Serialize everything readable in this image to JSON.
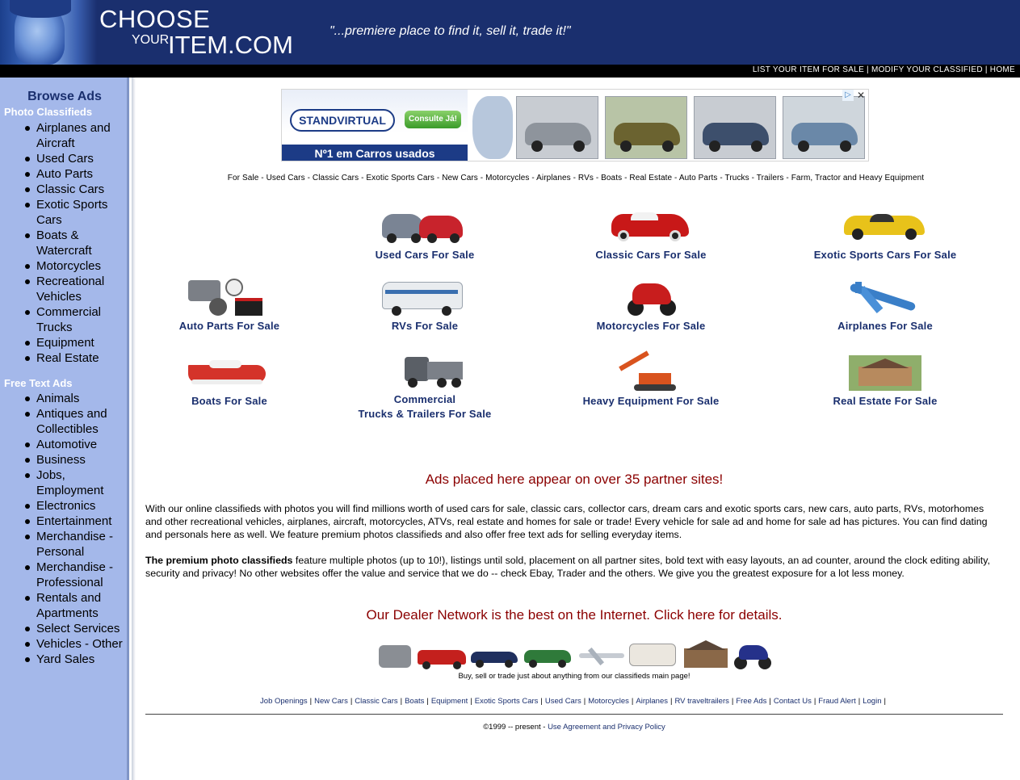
{
  "header": {
    "logo_line1": "CHOOSE",
    "logo_line2_small": "YOUR",
    "logo_line2_big": "ITEM.COM",
    "tagline": "\"...premiere place to find it, sell it, trade it!\"",
    "top_links": [
      "LIST YOUR ITEM FOR SALE",
      "MODIFY YOUR CLASSIFIED",
      "HOME"
    ]
  },
  "sidebar": {
    "title": "Browse Ads",
    "photo_section": "Photo Classifieds",
    "photo_items": [
      "Airplanes and Aircraft",
      "Used Cars",
      "Auto Parts",
      "Classic Cars",
      "Exotic Sports Cars",
      "Boats & Watercraft",
      "Motorcycles",
      "Recreational Vehicles",
      "Commercial Trucks",
      "Equipment",
      "Real Estate"
    ],
    "text_section": "Free Text Ads",
    "text_items": [
      "Animals",
      "Antiques and Collectibles",
      "Automotive",
      "Business",
      "Jobs, Employment",
      "Electronics",
      "Entertainment",
      "Merchandise - Personal",
      "Merchandise - Professional",
      "Rentals and Apartments",
      "Select Services",
      "Vehicles - Other",
      "Yard Sales"
    ]
  },
  "banner": {
    "brand": "STANDVIRTUAL",
    "button": "Consulte Já!",
    "strip": "Nº1 em Carros usados",
    "adchoices_icon": "adchoices-icon",
    "close_icon": "close-icon"
  },
  "category_line": "For Sale - Used Cars - Classic Cars - Exotic Sports Cars - New Cars - Motorcycles - Airplanes - RVs - Boats - Real Estate - Auto Parts - Trucks - Trailers - Farm, Tractor and Heavy Equipment",
  "categories": [
    {
      "label": "Used Cars For Sale"
    },
    {
      "label": "Classic Cars For Sale"
    },
    {
      "label": "Exotic Sports Cars For Sale"
    },
    {
      "label": "Auto Parts For Sale"
    },
    {
      "label": "RVs For Sale"
    },
    {
      "label": "Motorcycles For Sale"
    },
    {
      "label": "Airplanes For Sale"
    },
    {
      "label": "Boats For Sale"
    },
    {
      "label": "Commercial",
      "label2": "Trucks & Trailers For Sale"
    },
    {
      "label": "Heavy Equipment For Sale"
    },
    {
      "label": "Real Estate For Sale"
    }
  ],
  "headline1": "Ads placed here appear on over 35 partner sites!",
  "para1": "With our online classifieds with photos you will find millions worth of used cars for sale, classic cars, collector cars, dream cars and exotic sports cars, new cars, auto parts, RVs, motorhomes and other recreational vehicles, airplanes, aircraft, motorcycles, ATVs, real estate and homes for sale or trade! Every vehicle for sale ad and home for sale ad has pictures. You can find dating and personals here as well. We feature premium photos classifieds and also offer free text ads for selling everyday items.",
  "para2_bold": "The premium photo classifieds",
  "para2": " feature multiple photos (up to 10!), listings until sold, placement on all partner sites, bold text with easy layouts, an ad counter, around the clock editing ability, security and privacy! No other websites offer the value and service that we do -- check Ebay, Trader and the others. We give you the greatest exposure for a lot less money.",
  "headline2": "Our Dealer Network is the best on the Internet. Click here for details.",
  "thumbs_caption": "Buy, sell or trade just about anything from our classifieds main page!",
  "footer_links": [
    "Job Openings",
    "New Cars",
    "Classic Cars",
    "Boats",
    "Equipment",
    "Exotic Sports Cars",
    "Used Cars",
    "Motorcycles",
    "Airplanes",
    "RV traveltrailers",
    "Free Ads",
    "Contact Us",
    "Fraud Alert",
    "Login"
  ],
  "copyright_prefix": "©1999 -- present - ",
  "copyright_link": "Use Agreement and Privacy Policy",
  "colors": {
    "header_bg": "#1a2f6e",
    "sidebar_bg": "#a4b8ea",
    "link_navy": "#1a2f6e",
    "headline_red": "#8b0000"
  }
}
